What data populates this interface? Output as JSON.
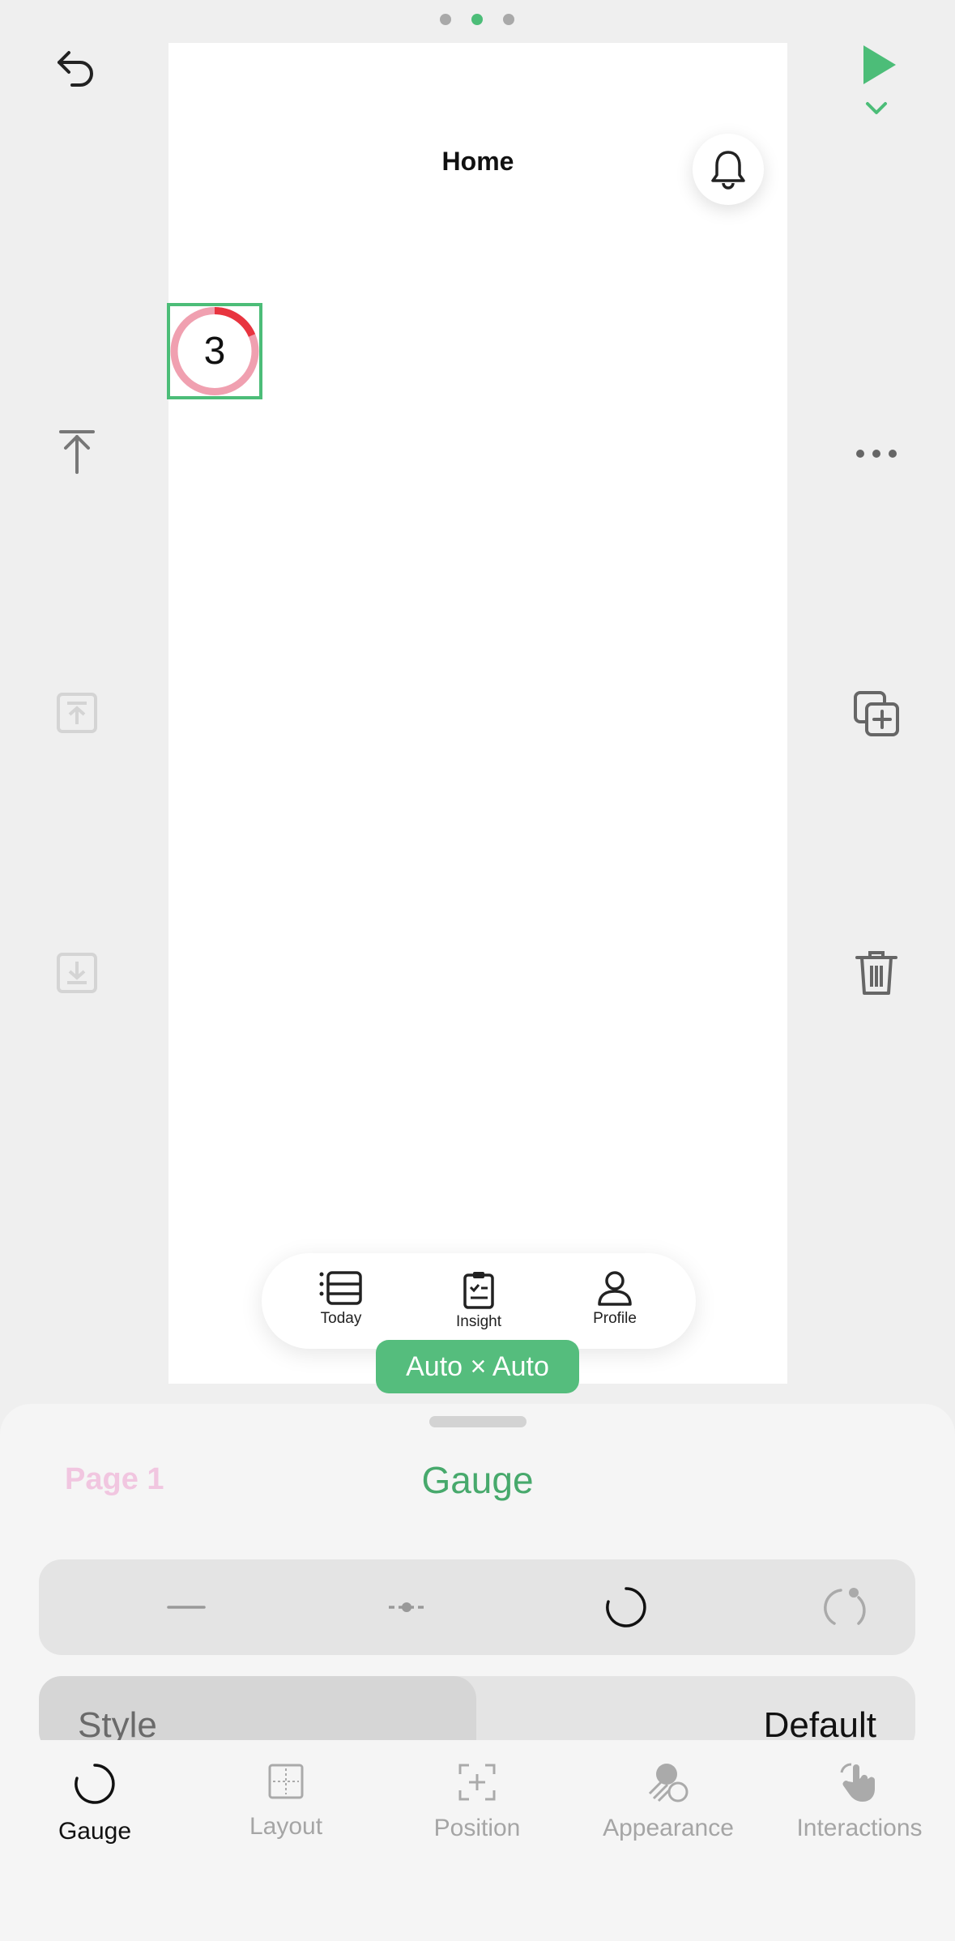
{
  "editor": {
    "page_dots": 3,
    "active_dot": 1
  },
  "canvas": {
    "title": "Home",
    "gauge_value": "3",
    "tabs": [
      {
        "label": "Today",
        "icon": "list-icon"
      },
      {
        "label": "Insight",
        "icon": "clipboard-check-icon"
      },
      {
        "label": "Profile",
        "icon": "person-icon"
      }
    ],
    "size_label": "Auto × Auto"
  },
  "sheet": {
    "page_label": "Page 1",
    "title": "Gauge",
    "segments": [
      "line-gauge-icon",
      "slider-gauge-icon",
      "ring-gauge-icon",
      "arc-gauge-icon"
    ],
    "active_segment": 2,
    "style_row": {
      "label": "Style",
      "value": "Default"
    }
  },
  "bottom_tabs": [
    {
      "label": "Gauge",
      "icon": "gauge-icon",
      "active": true
    },
    {
      "label": "Layout",
      "icon": "layout-icon",
      "active": false
    },
    {
      "label": "Position",
      "icon": "position-icon",
      "active": false
    },
    {
      "label": "Appearance",
      "icon": "appearance-icon",
      "active": false
    },
    {
      "label": "Interactions",
      "icon": "hand-pointer-icon",
      "active": false
    }
  ],
  "colors": {
    "accent": "#4cbd78",
    "gauge_track": "#f0a0b0",
    "gauge_progress": "#e8343f"
  }
}
